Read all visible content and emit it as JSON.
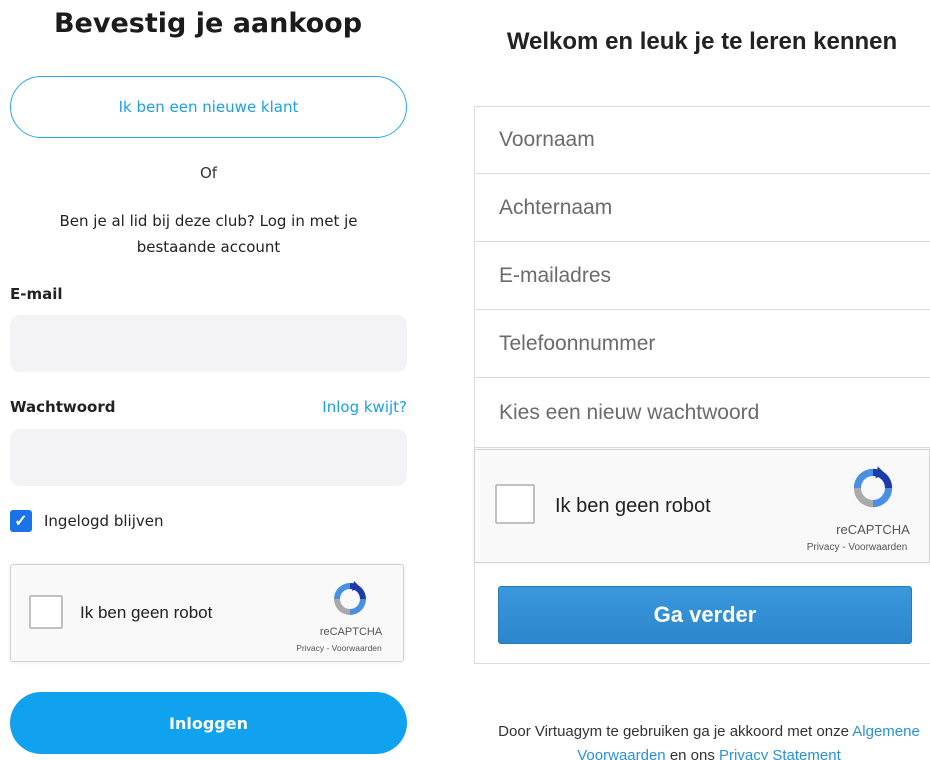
{
  "left": {
    "title": "Bevestig je aankoop",
    "new_client_button": "Ik ben een nieuwe klant",
    "or_text": "Of",
    "login_prompt": "Ben je al lid bij deze club? Log in met je bestaande account",
    "email_label": "E-mail",
    "password_label": "Wachtwoord",
    "forgot_link": "Inlog kwijt?",
    "remember_label": "Ingelogd blijven",
    "remember_checked": true,
    "captcha": {
      "label": "Ik ben geen robot",
      "brand": "reCAPTCHA",
      "links": "Privacy - Voorwaarden"
    },
    "login_button": "Inloggen"
  },
  "right": {
    "title": "Welkom en leuk je te leren kennen",
    "fields": {
      "firstname": "Voornaam",
      "lastname": "Achternaam",
      "email": "E-mailadres",
      "phone": "Telefoonnummer",
      "password": "Kies een nieuw wachtwoord"
    },
    "captcha": {
      "label": "Ik ben geen robot",
      "brand": "reCAPTCHA",
      "links": "Privacy - Voorwaarden"
    },
    "continue_button": "Ga verder",
    "terms": {
      "prefix": "Door Virtuagym te gebruiken ga je akkoord met onze ",
      "link1": "Algemene",
      "link1_cont": "Voorwaarden",
      "middle": " en ons ",
      "link2": "Privacy Statement"
    }
  },
  "colors": {
    "accent": "#1a9fe6",
    "login_button": "#10a2ee",
    "continue_button": "#3a98dc",
    "checkbox": "#1a73e8"
  }
}
